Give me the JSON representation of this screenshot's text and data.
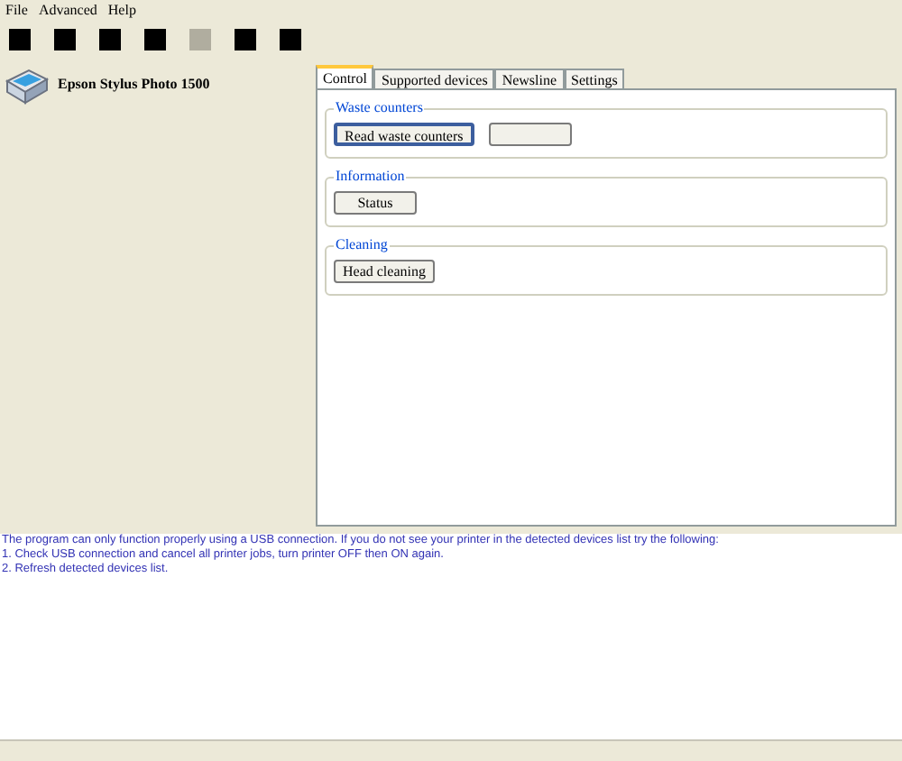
{
  "menu": [
    "File",
    "Advanced",
    "Help"
  ],
  "toolbar": [
    {
      "disabled": false
    },
    {
      "disabled": false
    },
    {
      "disabled": false
    },
    {
      "disabled": false
    },
    {
      "disabled": true
    },
    {
      "disabled": false
    },
    {
      "disabled": false
    }
  ],
  "devices": [
    {
      "name": "Epson Stylus Photo 1500",
      "selected": false
    }
  ],
  "tabs": [
    {
      "label": "Control",
      "selected": true
    },
    {
      "label": "Supported devices",
      "selected": false
    },
    {
      "label": "Newsline",
      "selected": false
    },
    {
      "label": "Settings",
      "selected": false
    }
  ],
  "groups": [
    {
      "title": "Waste counters",
      "buttons": [
        {
          "label": "Read waste counters",
          "focused": true
        },
        {
          "focused": false
        }
      ]
    },
    {
      "title": "Information",
      "buttons": [
        {
          "label": "Status",
          "focused": false
        }
      ]
    },
    {
      "title": "Cleaning",
      "buttons": [
        {
          "label": "Head cleaning",
          "focused": false
        }
      ]
    }
  ],
  "log": [
    "The program can only function properly using a USB connection. If you do not see your printer in the detected devices list try the following:",
    "1. Check USB connection and cancel all printer jobs, turn printer OFF then ON again.",
    "2. Refresh detected devices list."
  ]
}
